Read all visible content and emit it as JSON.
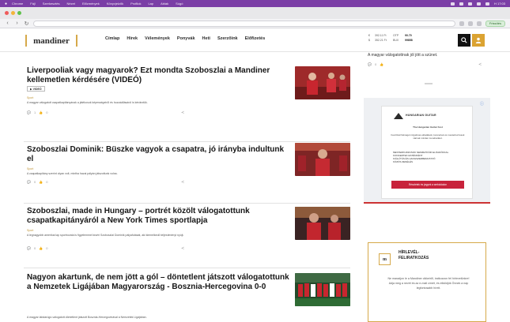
{
  "menubar": {
    "items": [
      "Chrome",
      "Fájl",
      "Szerkesztés",
      "Nézet",
      "Előzmények",
      "Könyvjelzők",
      "Profilok",
      "Lap",
      "Ablak",
      "Súgó"
    ],
    "clock": "H 17:03"
  },
  "browser": {
    "update_label": "Frissítés"
  },
  "site": {
    "logo_text": "mandiner",
    "nav": [
      "Címlap",
      "Hírek",
      "Vélemények",
      "Ponyvák",
      "Heti",
      "Szerzőink",
      "Előfizetés"
    ],
    "rates": [
      {
        "sym": "€",
        "value": "392.11 Ft",
        "label": "OTP",
        "change": "90.70"
      },
      {
        "sym": "$",
        "value": "352.21 Ft",
        "label": "BUX",
        "change": "99858"
      }
    ]
  },
  "articles": [
    {
      "title": "Liverpooliak vagy magyarok? Ezt mondta Szoboszlai a Mandiner kellemetlen kérdésére (VIDEÓ)",
      "tag": "VIDEÓ",
      "category": "Sport",
      "lead": "A magyar válogatott csapatkapitányának a játékosok képességeiről és hozzáállásáról is kérdeztük.",
      "comments": "1",
      "likes": "0"
    },
    {
      "title": "Szoboszlai Dominik: Büszke vagyok a csapatra, jó irányba indultunk el",
      "category": "Sport",
      "lead": "A csapatkapitány szerint olyan volt, mintha hazai pályán játszottunk volna.",
      "comments": "0",
      "likes": "0"
    },
    {
      "title": "Szoboszlai, made in Hungary – portrét közölt válogatottunk csapatkapitányáról a New York Times sportlapja",
      "category": "Sport",
      "lead": "A legnagyobb amerikai lap sportrovata is figyelemmel kíséri Szoboszlai Dominik pályafutását, aki kiemelkedő teljesítményt nyújt.",
      "comments": "0",
      "likes": "0"
    },
    {
      "title": "Nagyon akartunk, de nem jött a gól – döntetlent játszott válogatottunk a Nemzetek Ligájában Magyarország - Bosznia-Hercegovina 0-0",
      "category": "Sport",
      "lead": "A magyar labdarúgó-válogatott döntetlent játszott Bosznia-Hercegovinával a Nemzetek Ligájában.",
      "comments": "0",
      "likes": "0"
    }
  ],
  "sidebar": {
    "top_text": "A magyar válogatottnak jól jött a szünet.",
    "top_comments": "0",
    "ad": {
      "brand": "HUNGARIAN GUITAR",
      "headline": "The Hungarian Guitar Fest",
      "body": "Fesztivál hétvégén izgalmas előadások, koncertek és mesterkurzusok várnak minden zenebarátot.",
      "list": [
        "MESTERKURZUSOK NEMZETKÖZI ELŐADÓKKAL",
        "KONCERTEK ESTÉNKÉNT",
        "KIÁLLÍTÁS ÉS HANGSZERBEMUTATÓ",
        "KÖZÖS ZENÉLÉS"
      ],
      "cta": "Részletek és jegyek a weboldalon"
    },
    "newsletter": {
      "badge": "m",
      "title": "HÍRLEVÉL-FELIRATKOZÁS",
      "text": "Ne maradjon le a Mandiner cikkeiről, iratkozzon fel hírlevelünkre! Adja meg a nevét és az e-mail címét, és elküldjük Önnek a nap legfontosabb híreit."
    }
  },
  "icons": {
    "comment": "comment-icon",
    "like": "like-icon",
    "share": "share-icon",
    "search": "search-icon",
    "user": "user-icon"
  },
  "colors": {
    "menubar": "#7b3ea6",
    "accent_gold": "#d6a94a",
    "category": "#c19536",
    "ad_red": "#c8233b"
  }
}
